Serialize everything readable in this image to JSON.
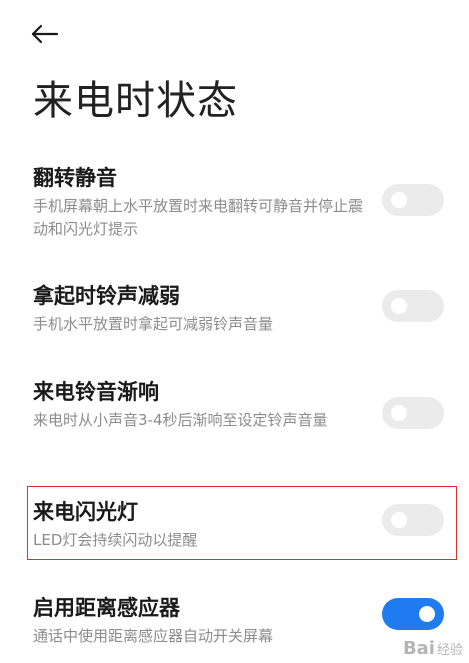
{
  "header": {
    "back_icon": "arrow-left-icon",
    "title": "来电时状态"
  },
  "settings": [
    {
      "title": "翻转静音",
      "desc": "手机屏幕朝上水平放置时来电翻转可静音并停止震动和闪光灯提示",
      "enabled": false
    },
    {
      "title": "拿起时铃声减弱",
      "desc": "手机水平放置时拿起可减弱铃声音量",
      "enabled": false
    },
    {
      "title": "来电铃音渐响",
      "desc": "来电时从小声音3-4秒后渐响至设定铃声音量",
      "enabled": false
    },
    {
      "title": "来电闪光灯",
      "desc": "LED灯会持续闪动以提醒",
      "enabled": false
    },
    {
      "title": "启用距离感应器",
      "desc": "通话中使用距离感应器自动开关屏幕",
      "enabled": true
    }
  ],
  "watermark": {
    "brand": "Bai",
    "suffix": "经验"
  },
  "colors": {
    "toggle_on": "#1e7bf0",
    "toggle_off": "#ebebeb",
    "highlight": "#d9322c"
  }
}
